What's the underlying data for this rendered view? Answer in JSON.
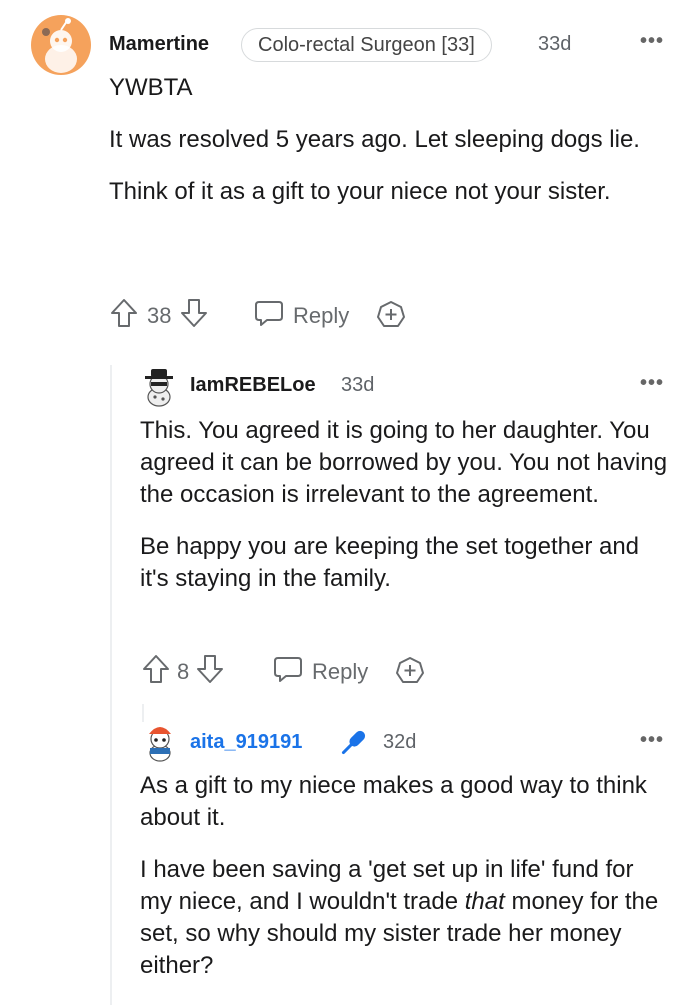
{
  "comments": [
    {
      "username": "Mamertine",
      "flair": "Colo-rectal Surgeon [33]",
      "age": "33d",
      "paragraphs": [
        "YWBTA",
        "It was resolved 5 years ago. Let sleeping dogs lie.",
        "Think of it as a gift to your niece not your sister."
      ],
      "votes": "38",
      "reply_label": "Reply"
    },
    {
      "username": "IamREBELoe",
      "age": "33d",
      "paragraphs": [
        "This. You agreed it is going to her daughter. You agreed it can be borrowed by you. You not having the occasion is irrelevant to the agreement.",
        "Be happy you are keeping the set together and it's staying in the family."
      ],
      "votes": "8",
      "reply_label": "Reply"
    },
    {
      "username": "aita_919191",
      "age": "32d",
      "paragraphs": [
        "As a gift to my niece makes a good way to think about it.",
        "I have been saving a 'get set up in life' fund for my niece, and I wouldn't trade",
        "that",
        "money for the set, so why should my sister trade her money either?"
      ]
    }
  ],
  "more_label": "•••",
  "colors": {
    "op_blue": "#1a73e8",
    "avatar_orange": "#f5a25c"
  }
}
